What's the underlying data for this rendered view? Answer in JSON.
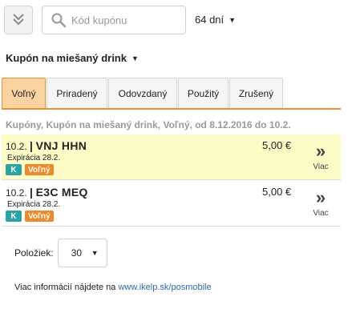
{
  "header": {
    "collapse_icon": "double-chevron-down-icon",
    "search": {
      "placeholder": "Kód kupónu",
      "value": "",
      "icon": "search-icon"
    },
    "days": {
      "label": "64 dní"
    }
  },
  "coupon_type": {
    "label": "Kupón na miešaný drink"
  },
  "tabs": [
    {
      "label": "Voľný",
      "active": true
    },
    {
      "label": "Priradený",
      "active": false
    },
    {
      "label": "Odovzdaný",
      "active": false
    },
    {
      "label": "Použitý",
      "active": false
    },
    {
      "label": "Zrušený",
      "active": false
    }
  ],
  "summary": "Kupóny, Kupón na miešaný drink, Voľný, od 8.12.2016 do 10.2.",
  "coupons": [
    {
      "date": "10.2.",
      "separator": "|",
      "code": "VNJ HHN",
      "expiry": "Expirácia 28.2.",
      "badge_k": "K",
      "status": "Voľný",
      "price": "5,00 €",
      "more_label": "Viac",
      "highlighted": true
    },
    {
      "date": "10.2.",
      "separator": "|",
      "code": "E3C MEQ",
      "expiry": "Expirácia 28.2.",
      "badge_k": "K",
      "status": "Voľný",
      "price": "5,00 €",
      "more_label": "Viac",
      "highlighted": false
    }
  ],
  "pager": {
    "label": "Položiek:",
    "value": "30"
  },
  "footer": {
    "text": "Viac informácií nájdete na",
    "link": "www.ikelp.sk/posmobile"
  },
  "colors": {
    "accent": "#e8912f",
    "active_tab": "#fbd3a2",
    "highlight_row": "#fdfcc7",
    "badge_k": "#2ba3a3",
    "badge_status": "#ee8a2a",
    "link": "#2e6aa8"
  }
}
